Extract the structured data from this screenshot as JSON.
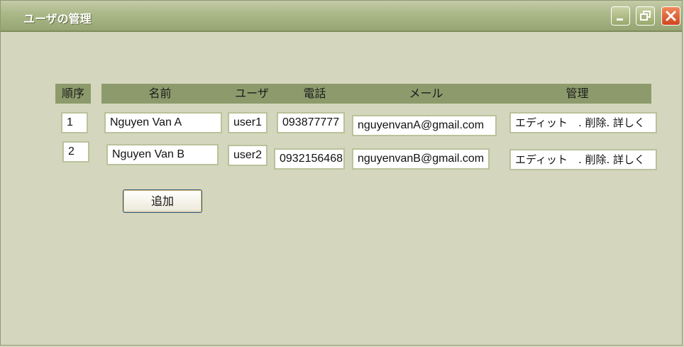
{
  "window": {
    "title": "ユーザの管理"
  },
  "table": {
    "headers": {
      "seq": "順序",
      "name": "名前",
      "user": "ユーザ",
      "phone": "電話",
      "mail": "メール",
      "manage": "管理"
    },
    "rows": [
      {
        "seq": "1",
        "name": "Nguyen Van A",
        "user": "user1",
        "phone": "093877777",
        "mail": "nguyenvanA@gmail.com",
        "actions": "エディット　. 削除. 詳しく"
      },
      {
        "seq": "2",
        "name": "Nguyen Van B",
        "user": "user2",
        "phone": "0932156468",
        "mail": "nguyenvanB@gmail.com",
        "actions": "エディット　. 削除. 詳しく"
      }
    ]
  },
  "buttons": {
    "add": "追加"
  },
  "icons": {
    "minimize": "minimize-icon",
    "restore": "restore-icon",
    "close": "close-icon"
  }
}
